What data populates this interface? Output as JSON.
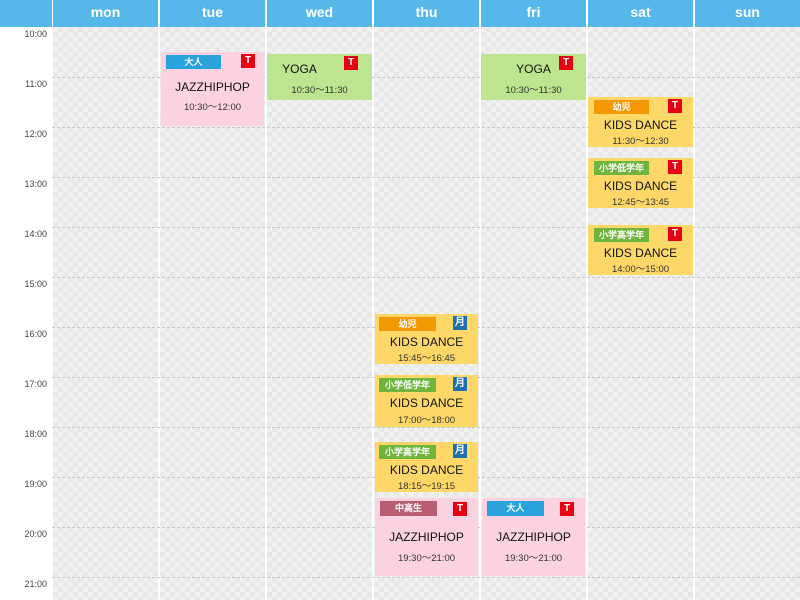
{
  "days": [
    "mon",
    "tue",
    "wed",
    "thu",
    "fri",
    "sat",
    "sun"
  ],
  "times": [
    "10:00",
    "11:00",
    "12:00",
    "13:00",
    "14:00",
    "15:00",
    "16:00",
    "17:00",
    "18:00",
    "19:00",
    "20:00",
    "21:00"
  ],
  "colors": {
    "header": "#56b8ea",
    "adult_tag": "#2aa3dc",
    "kinder_tag": "#f39800",
    "lower_tag": "#6fb53d",
    "upper_tag": "#6fb53d",
    "highschool_tag": "#b75e75",
    "t_badge": "#e60012",
    "mon_badge": "#1d6fb0"
  },
  "events": {
    "tue_jazz": {
      "tag": "大人",
      "badge": "T",
      "title": "JAZZHIPHOP",
      "time": "10:30〜12:00"
    },
    "wed_yoga": {
      "badge": "T",
      "title": "YOGA",
      "time": "10:30〜11:30"
    },
    "thu_kids1": {
      "tag": "幼児",
      "badge": "月",
      "title": "KIDS DANCE",
      "time": "15:45〜16:45"
    },
    "thu_kids2": {
      "tag": "小学低学年",
      "badge": "月",
      "title": "KIDS DANCE",
      "time": "17:00〜18:00"
    },
    "thu_kids3": {
      "tag": "小学高学年",
      "badge": "月",
      "title": "KIDS DANCE",
      "time": "18:15〜19:15"
    },
    "thu_jazz": {
      "tag": "中高生",
      "badge": "T",
      "title": "JAZZHIPHOP",
      "time": "19:30〜21:00"
    },
    "fri_yoga": {
      "badge": "T",
      "title": "YOGA",
      "time": "10:30〜11:30"
    },
    "fri_jazz": {
      "tag": "大人",
      "badge": "T",
      "title": "JAZZHIPHOP",
      "time": "19:30〜21:00"
    },
    "sat_kids1": {
      "tag": "幼児",
      "badge": "T",
      "title": "KIDS DANCE",
      "time": "11:30〜12:30"
    },
    "sat_kids2": {
      "tag": "小学低学年",
      "badge": "T",
      "title": "KIDS DANCE",
      "time": "12:45〜13:45"
    },
    "sat_kids3": {
      "tag": "小学高学年",
      "badge": "T",
      "title": "KIDS DANCE",
      "time": "14:00〜15:00"
    }
  }
}
